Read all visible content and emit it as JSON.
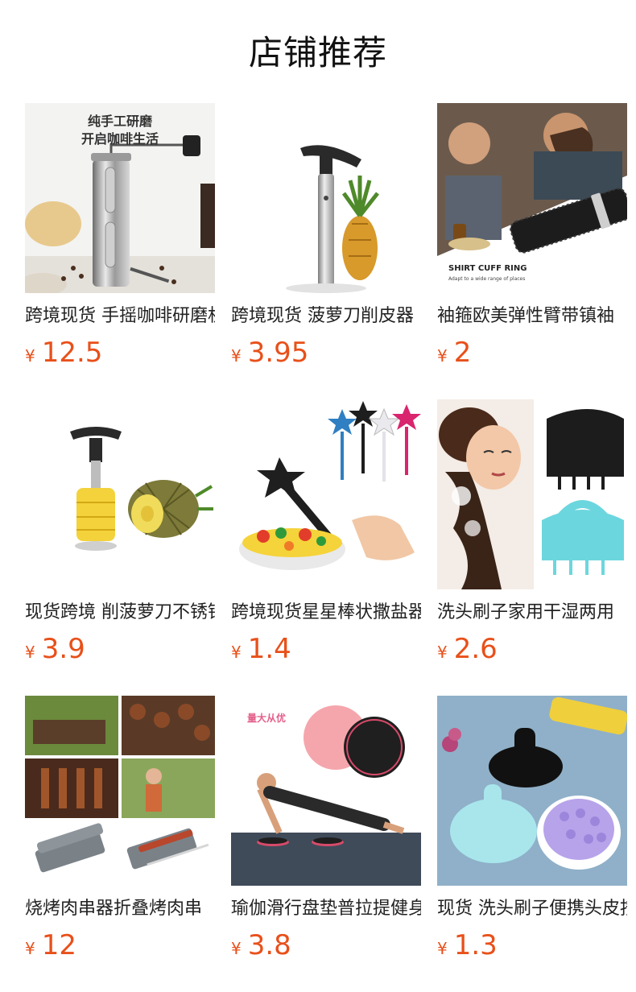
{
  "page_title": "店铺推荐",
  "currency_symbol": "¥",
  "products": [
    {
      "name": "跨境现货 手摇咖啡研磨机",
      "price": "12.5",
      "image_text": [
        "纯手工研磨",
        "开启咖啡生活"
      ],
      "image": "coffee-grinder"
    },
    {
      "name": "跨境现货 菠萝刀削皮器",
      "price": "3.95",
      "image": "pineapple-slicer-steel"
    },
    {
      "name": "袖箍欧美弹性臂带镇袖",
      "price": "2",
      "image_text": [
        "SHIRT CUFF RING",
        "Adapt to a wide range of places"
      ],
      "image": "shirt-cuff-ring"
    },
    {
      "name": "现货跨境 削菠萝刀不锈钢",
      "price": "3.9",
      "image": "pineapple-corer"
    },
    {
      "name": "跨境现货星星棒状撒盐器",
      "price": "1.4",
      "image": "star-wand-tool"
    },
    {
      "name": "洗头刷子家用干湿两用",
      "price": "2.6",
      "image": "shampoo-brush-model"
    },
    {
      "name": "烧烤肉串器折叠烤肉串",
      "price": "12",
      "image": "bbq-skewer-maker"
    },
    {
      "name": "瑜伽滑行盘垫普拉提健身",
      "price": "3.8",
      "image_text": [
        "量大从优"
      ],
      "image": "yoga-slider"
    },
    {
      "name": "现货 洗头刷子便携头皮按摩",
      "price": "1.3",
      "image": "shampoo-brush"
    }
  ]
}
